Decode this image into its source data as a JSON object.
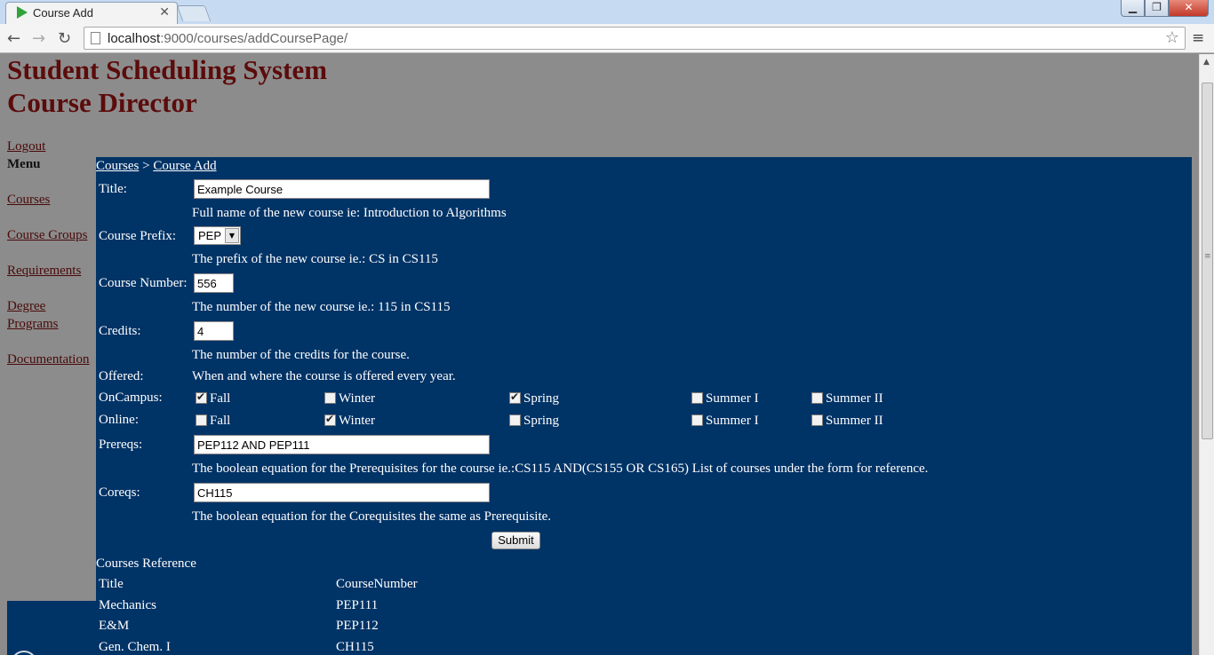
{
  "browser": {
    "tab_title": "Course Add",
    "tab_close": "✕",
    "url_host": "localhost",
    "url_rest": ":9000/courses/addCoursePage/",
    "window_buttons": {
      "minimize": "▁",
      "maximize": "❐",
      "close": "✕"
    }
  },
  "header": {
    "line1": "Student Scheduling System",
    "line2": "Course Director"
  },
  "sidebar": {
    "logout": "Logout",
    "menu_heading": "Menu",
    "items": [
      "Courses",
      "Course Groups",
      "Requirements",
      "Degree",
      "Programs",
      "Documentation"
    ]
  },
  "breadcrumb": {
    "first": "Courses",
    "sep": " > ",
    "second": "Course Add"
  },
  "form": {
    "title_label": "Title:",
    "title_value": "Example Course",
    "title_help": "Full name of the new course ie: Introduction to Algorithms",
    "prefix_label": "Course Prefix:",
    "prefix_value": "PEP",
    "prefix_help": "The prefix of the new course ie.: CS in CS115",
    "number_label": "Course Number:",
    "number_value": "556",
    "number_help": "The number of the new course ie.: 115 in CS115",
    "credits_label": "Credits:",
    "credits_value": "4",
    "credits_help": "The number of the credits for the course.",
    "offered_label": "Offered:",
    "offered_help": "When and where the course is offered every year.",
    "oncampus_label": "OnCampus:",
    "online_label": "Online:",
    "terms": [
      "Fall",
      "Winter",
      "Spring",
      "Summer I",
      "Summer II"
    ],
    "oncampus_checked": [
      true,
      false,
      true,
      false,
      false
    ],
    "online_checked": [
      false,
      true,
      false,
      false,
      false
    ],
    "prereqs_label": "Prereqs:",
    "prereqs_value": "PEP112 AND PEP111",
    "prereqs_help": "The boolean equation for the Prerequisites for the course ie.:CS115 AND(CS155 OR CS165) List of courses under the form for reference.",
    "coreqs_label": "Coreqs:",
    "coreqs_value": "CH115",
    "coreqs_help": "The boolean equation for the Corequisites the same as Prerequisite.",
    "submit": "Submit"
  },
  "reference": {
    "heading": "Courses Reference",
    "columns": [
      "Title",
      "CourseNumber"
    ],
    "rows": [
      [
        "Mechanics",
        "PEP111"
      ],
      [
        "E&M",
        "PEP112"
      ],
      [
        "Gen. Chem. I",
        "CH115"
      ]
    ]
  }
}
